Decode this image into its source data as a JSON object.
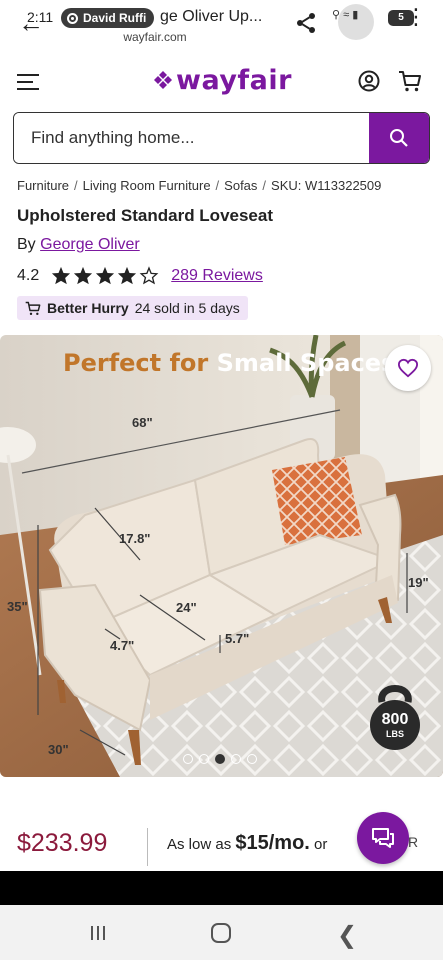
{
  "status": {
    "time": "2:11",
    "battery": "5"
  },
  "browser": {
    "recording_user": "David Ruffi",
    "page_title_truncated": "ge Oliver Up...",
    "url": "wayfair.com"
  },
  "header": {
    "logo_text": "wayfair",
    "brand_color": "#7b189f"
  },
  "search": {
    "placeholder": "Find anything home..."
  },
  "breadcrumb": {
    "items": [
      "Furniture",
      "Living Room Furniture",
      "Sofas"
    ],
    "sku": "SKU: W113322509"
  },
  "product": {
    "title": "Upholstered Standard Loveseat",
    "by_prefix": "By",
    "brand": "George Oliver",
    "rating": "4.2",
    "rating_value": 4.2,
    "reviews": "289 Reviews",
    "hurry_label": "Better Hurry",
    "hurry_detail": "24 sold in 5 days"
  },
  "image": {
    "headline_part1": "Perfect for",
    "headline_part2": "Small Spaces",
    "dims": {
      "width": "68\"",
      "back": "17.8\"",
      "seat": "24\"",
      "arm": "4.7\"",
      "cushion": "5.7\"",
      "height": "35\"",
      "seat_height": "19\"",
      "depth": "30\""
    },
    "capacity_value": "800",
    "capacity_unit": "LBS",
    "carousel_count": 5,
    "carousel_active": 2
  },
  "pricing": {
    "price": "$233.99",
    "finance_prefix": "As low as",
    "finance_amount": "$15/mo.",
    "finance_suffix": "or",
    "price_color": "#8b1a3c"
  }
}
